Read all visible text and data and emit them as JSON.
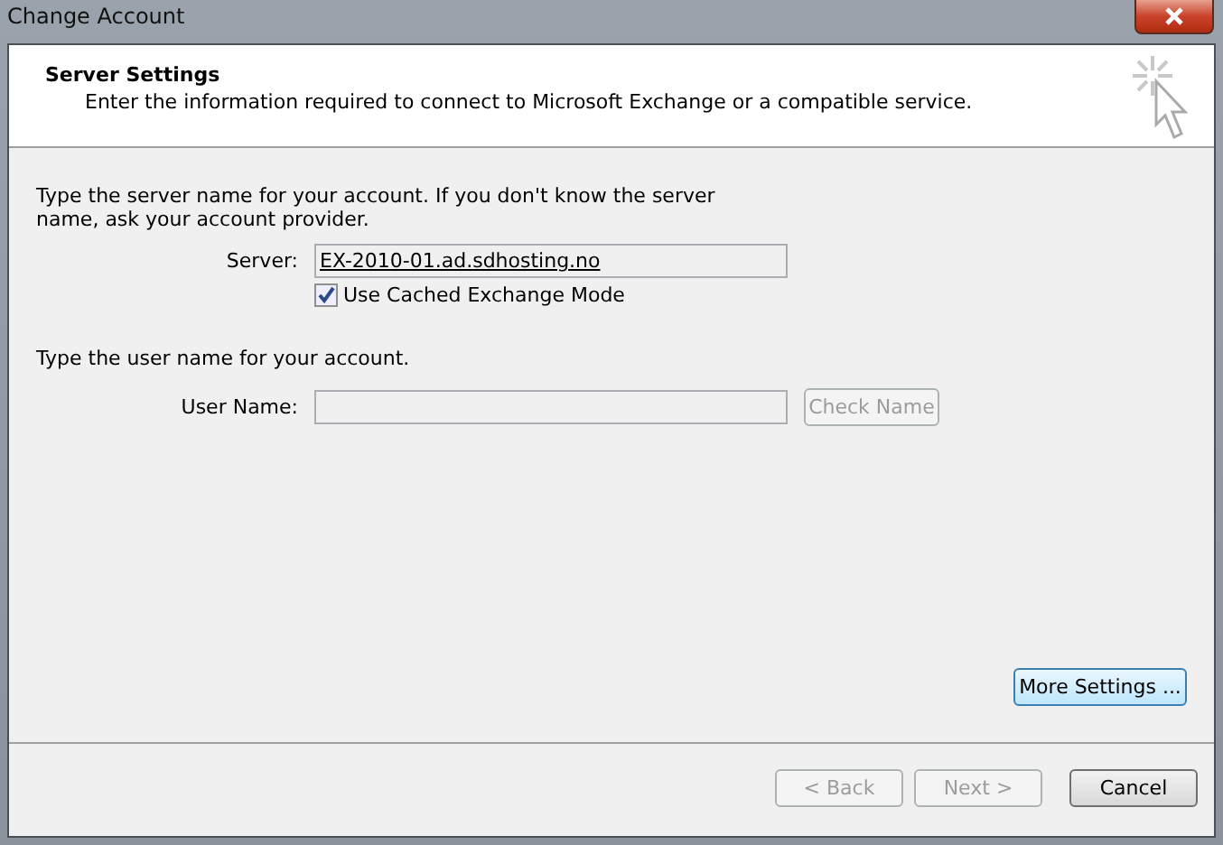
{
  "window": {
    "title": "Change Account"
  },
  "header": {
    "title": "Server Settings",
    "subtitle": "Enter the information required to connect to Microsoft Exchange or a compatible service."
  },
  "server_section": {
    "prompt": "Type the server name for your account. If you don't know the server name, ask your account provider.",
    "label": "Server:",
    "value": "EX-2010-01.ad.sdhosting.no",
    "cached_mode": {
      "label": "Use Cached Exchange Mode",
      "checked": true
    }
  },
  "user_section": {
    "prompt": "Type the user name for your account.",
    "label": "User Name:",
    "check_button": {
      "label": "Check Name",
      "disabled": true
    }
  },
  "more_settings": {
    "label": "More Settings ...",
    "disabled": false
  },
  "buttons": [
    {
      "label": "< Back",
      "disabled": true
    },
    {
      "label": "Next >",
      "disabled": true
    },
    {
      "label": "Cancel",
      "disabled": false
    }
  ]
}
